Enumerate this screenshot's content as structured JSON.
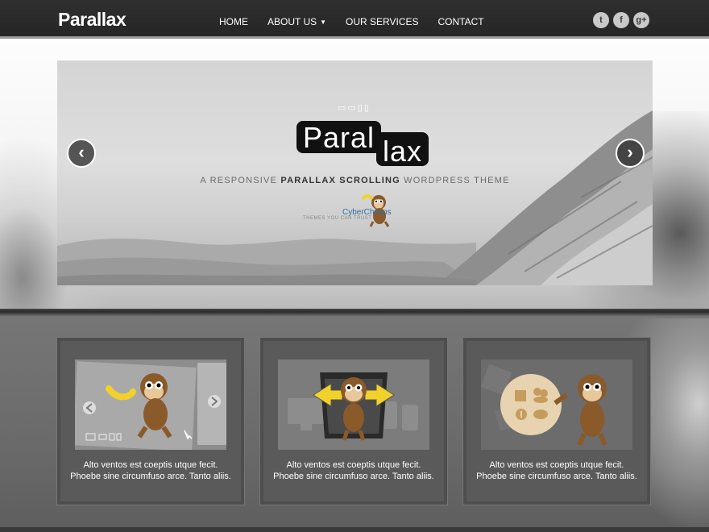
{
  "header": {
    "brand": "Parallax",
    "nav": [
      {
        "label": "HOME"
      },
      {
        "label": "ABOUT US",
        "dropdown": true
      },
      {
        "label": "OUR SERVICES"
      },
      {
        "label": "CONTACT"
      }
    ],
    "social": [
      {
        "icon": "twitter-icon",
        "glyph": "t"
      },
      {
        "icon": "facebook-icon",
        "glyph": "f"
      },
      {
        "icon": "google-plus-icon",
        "glyph": "g+"
      }
    ]
  },
  "slider": {
    "logo_part1": "Paral",
    "logo_part2": "lax",
    "tagline_pre": "A RESPONSIVE ",
    "tagline_bold": "PARALLAX SCROLLING",
    "tagline_post": " WORDPRESS THEME",
    "company_name": "CyberChimps",
    "company_tagline": "THEMES YOU CAN TRUST",
    "device_icons": "▭▭▯▯",
    "prev_glyph": "‹",
    "next_glyph": "›"
  },
  "features": [
    {
      "line1": "Alto ventos est coeptis utque fecit.",
      "line2": "Phoebe sine circumfuso arce. Tanto aliis."
    },
    {
      "line1": "Alto ventos est coeptis utque fecit.",
      "line2": "Phoebe sine circumfuso arce. Tanto aliis."
    },
    {
      "line1": "Alto ventos est coeptis utque fecit.",
      "line2": "Phoebe sine circumfuso arce. Tanto aliis."
    }
  ],
  "colors": {
    "header_bg": "#2a2a2a",
    "accent_yellow": "#f2d22a",
    "monkey_brown": "#8a5a2b",
    "link_blue": "#2d6ea3"
  }
}
